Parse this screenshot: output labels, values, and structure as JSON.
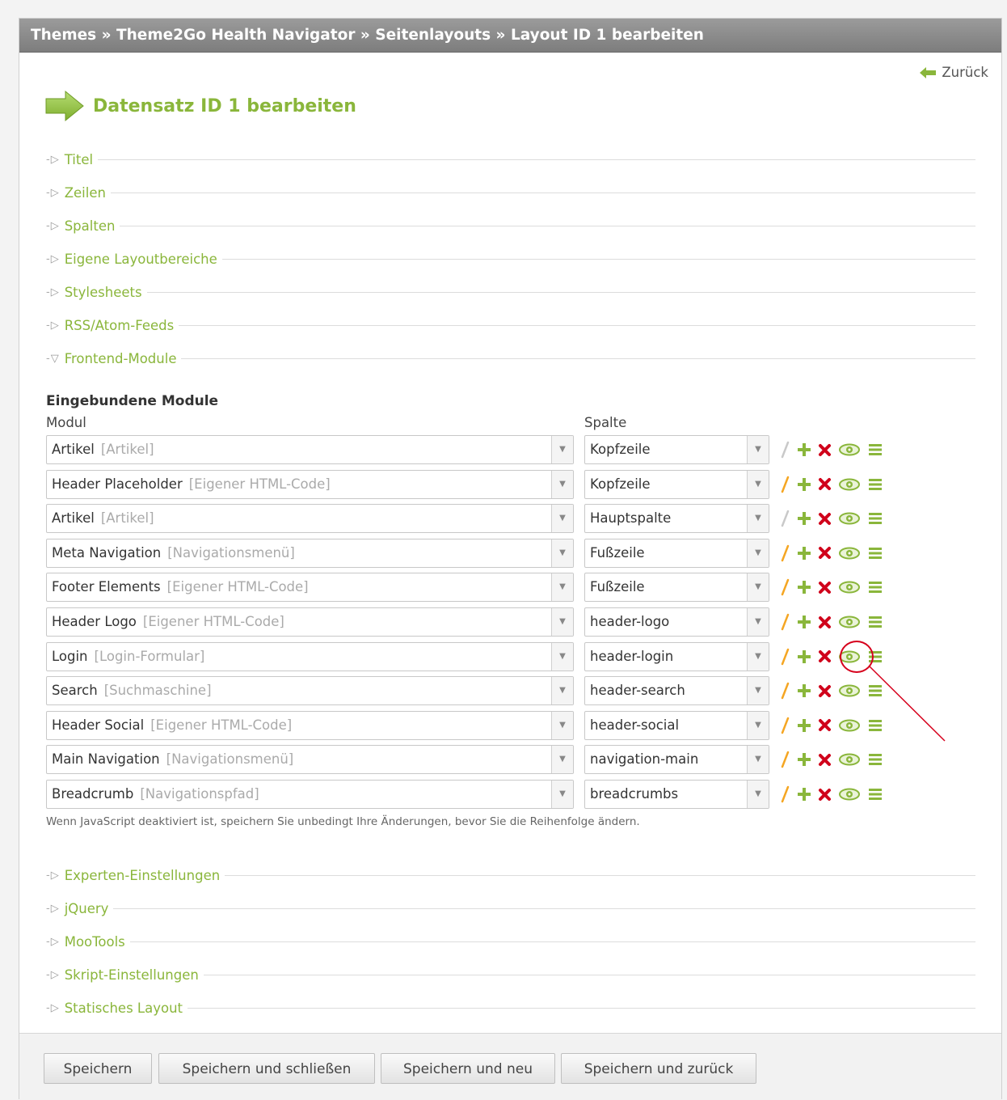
{
  "header": {
    "breadcrumb": "Themes » Theme2Go Health Navigator » Seitenlayouts » Layout ID 1 bearbeiten"
  },
  "back_link": {
    "label": "Zurück"
  },
  "page_title": "Datensatz ID 1 bearbeiten",
  "sections_top": [
    {
      "label": "Titel",
      "expanded": false
    },
    {
      "label": "Zeilen",
      "expanded": false
    },
    {
      "label": "Spalten",
      "expanded": false
    },
    {
      "label": "Eigene Layoutbereiche",
      "expanded": false
    },
    {
      "label": "Stylesheets",
      "expanded": false
    },
    {
      "label": "RSS/Atom-Feeds",
      "expanded": false
    },
    {
      "label": "Frontend-Module",
      "expanded": true
    }
  ],
  "modules": {
    "heading": "Eingebundene Module",
    "col_module": "Modul",
    "col_column": "Spalte",
    "rows": [
      {
        "name": "Artikel",
        "type": "[Artikel]",
        "column": "Kopfzeile",
        "edit_enabled": false
      },
      {
        "name": "Header Placeholder",
        "type": "[Eigener HTML-Code]",
        "column": "Kopfzeile",
        "edit_enabled": true
      },
      {
        "name": "Artikel",
        "type": "[Artikel]",
        "column": "Hauptspalte",
        "edit_enabled": false
      },
      {
        "name": "Meta Navigation",
        "type": "[Navigationsmenü]",
        "column": "Fußzeile",
        "edit_enabled": true
      },
      {
        "name": "Footer Elements",
        "type": "[Eigener HTML-Code]",
        "column": "Fußzeile",
        "edit_enabled": true
      },
      {
        "name": "Header Logo",
        "type": "[Eigener HTML-Code]",
        "column": "header-logo",
        "edit_enabled": true
      },
      {
        "name": "Login",
        "type": "[Login-Formular]",
        "column": "header-login",
        "edit_enabled": true
      },
      {
        "name": "Search",
        "type": "[Suchmaschine]",
        "column": "header-search",
        "edit_enabled": true
      },
      {
        "name": "Header Social",
        "type": "[Eigener HTML-Code]",
        "column": "header-social",
        "edit_enabled": true
      },
      {
        "name": "Main Navigation",
        "type": "[Navigationsmenü]",
        "column": "navigation-main",
        "edit_enabled": true
      },
      {
        "name": "Breadcrumb",
        "type": "[Navigationspfad]",
        "column": "breadcrumbs",
        "edit_enabled": true
      }
    ],
    "hint": "Wenn JavaScript deaktiviert ist, speichern Sie unbedingt Ihre Änderungen, bevor Sie die Reihenfolge ändern."
  },
  "sections_bottom": [
    {
      "label": "Experten-Einstellungen",
      "expanded": false
    },
    {
      "label": "jQuery",
      "expanded": false
    },
    {
      "label": "MooTools",
      "expanded": false
    },
    {
      "label": "Skript-Einstellungen",
      "expanded": false
    },
    {
      "label": "Statisches Layout",
      "expanded": false
    }
  ],
  "buttons": {
    "save": "Speichern",
    "save_close": "Speichern und schließen",
    "save_new": "Speichern und neu",
    "save_back": "Speichern und zurück"
  },
  "colors": {
    "accent_green": "#8ab63b",
    "edit_orange": "#f5a623",
    "delete_red": "#d0021b",
    "highlight_red": "#d6001c",
    "titlebar_gray": "#8a8a8a"
  },
  "icons": [
    "back-arrow-icon",
    "headline-arrow-icon",
    "edit-icon",
    "add-icon",
    "delete-icon",
    "toggle-visibility-icon",
    "drag-handle-icon",
    "chevron-down-icon",
    "triangle-right-icon",
    "triangle-down-icon"
  ]
}
